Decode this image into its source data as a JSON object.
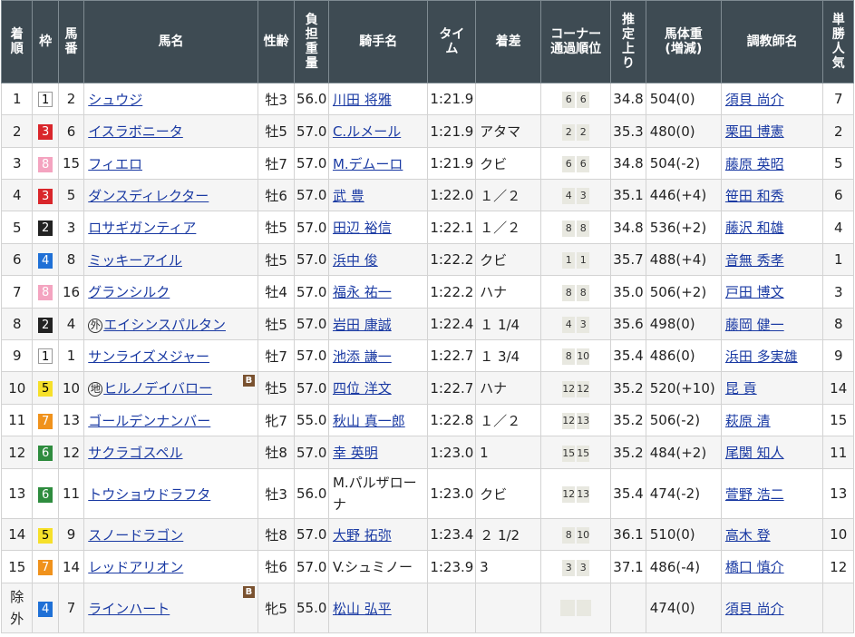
{
  "headers": {
    "chakujun": "着順",
    "waku": "枠",
    "umaban": "馬番",
    "bamei": "馬名",
    "seirei": "性齢",
    "futan": "負担重量",
    "kishu": "騎手名",
    "time": "タイム",
    "chakusa": "着差",
    "corner": "コーナー通過順位",
    "agari": "推定上り",
    "bataiju": "馬体重(増減)",
    "chokyoshi": "調教師名",
    "ninki": "単勝人気"
  },
  "rows": [
    {
      "pos": "1",
      "waku": "1",
      "num": "2",
      "prefix": "",
      "name": "シュウジ",
      "b": false,
      "sex": "牡3",
      "wt": "56.0",
      "jockey": "川田 将雅",
      "jlink": true,
      "time": "1:21.9",
      "margin": "",
      "c1": "6",
      "c2": "6",
      "agari": "34.8",
      "bw": "504(0)",
      "trainer": "須貝 尚介",
      "pop": "7"
    },
    {
      "pos": "2",
      "waku": "3",
      "num": "6",
      "prefix": "",
      "name": "イスラボニータ",
      "b": false,
      "sex": "牡5",
      "wt": "57.0",
      "jockey": "C.ルメール",
      "jlink": true,
      "time": "1:21.9",
      "margin": "アタマ",
      "c1": "2",
      "c2": "2",
      "agari": "35.3",
      "bw": "480(0)",
      "trainer": "栗田 博憲",
      "pop": "2"
    },
    {
      "pos": "3",
      "waku": "8",
      "num": "15",
      "prefix": "",
      "name": "フィエロ",
      "b": false,
      "sex": "牡7",
      "wt": "57.0",
      "jockey": "M.デムーロ",
      "jlink": true,
      "time": "1:21.9",
      "margin": "クビ",
      "c1": "6",
      "c2": "6",
      "agari": "34.8",
      "bw": "504(-2)",
      "trainer": "藤原 英昭",
      "pop": "5"
    },
    {
      "pos": "4",
      "waku": "3",
      "num": "5",
      "prefix": "",
      "name": "ダンスディレクター",
      "b": false,
      "sex": "牡6",
      "wt": "57.0",
      "jockey": "武 豊",
      "jlink": true,
      "time": "1:22.0",
      "margin": "１／２",
      "c1": "4",
      "c2": "3",
      "agari": "35.1",
      "bw": "446(+4)",
      "trainer": "笹田 和秀",
      "pop": "6"
    },
    {
      "pos": "5",
      "waku": "2",
      "num": "3",
      "prefix": "",
      "name": "ロサギガンティア",
      "b": false,
      "sex": "牡5",
      "wt": "57.0",
      "jockey": "田辺 裕信",
      "jlink": true,
      "time": "1:22.1",
      "margin": "１／２",
      "c1": "8",
      "c2": "8",
      "agari": "34.8",
      "bw": "536(+2)",
      "trainer": "藤沢 和雄",
      "pop": "4"
    },
    {
      "pos": "6",
      "waku": "4",
      "num": "8",
      "prefix": "",
      "name": "ミッキーアイル",
      "b": false,
      "sex": "牡5",
      "wt": "57.0",
      "jockey": "浜中 俊",
      "jlink": true,
      "time": "1:22.2",
      "margin": "クビ",
      "c1": "1",
      "c2": "1",
      "agari": "35.7",
      "bw": "488(+4)",
      "trainer": "音無 秀孝",
      "pop": "1"
    },
    {
      "pos": "7",
      "waku": "8",
      "num": "16",
      "prefix": "",
      "name": "グランシルク",
      "b": false,
      "sex": "牡4",
      "wt": "57.0",
      "jockey": "福永 祐一",
      "jlink": true,
      "time": "1:22.2",
      "margin": "ハナ",
      "c1": "8",
      "c2": "8",
      "agari": "35.0",
      "bw": "506(+2)",
      "trainer": "戸田 博文",
      "pop": "3"
    },
    {
      "pos": "8",
      "waku": "2",
      "num": "4",
      "prefix": "外",
      "name": "エイシンスパルタン",
      "b": false,
      "sex": "牡5",
      "wt": "57.0",
      "jockey": "岩田 康誠",
      "jlink": true,
      "time": "1:22.4",
      "margin": "１ 1/4",
      "c1": "4",
      "c2": "3",
      "agari": "35.6",
      "bw": "498(0)",
      "trainer": "藤岡 健一",
      "pop": "8"
    },
    {
      "pos": "9",
      "waku": "1",
      "num": "1",
      "prefix": "",
      "name": "サンライズメジャー",
      "b": false,
      "sex": "牡7",
      "wt": "57.0",
      "jockey": "池添 謙一",
      "jlink": true,
      "time": "1:22.7",
      "margin": "１ 3/4",
      "c1": "8",
      "c2": "10",
      "agari": "35.4",
      "bw": "486(0)",
      "trainer": "浜田 多実雄",
      "pop": "9"
    },
    {
      "pos": "10",
      "waku": "5",
      "num": "10",
      "prefix": "地",
      "name": "ヒルノデイバロー",
      "b": true,
      "sex": "牡5",
      "wt": "57.0",
      "jockey": "四位 洋文",
      "jlink": true,
      "time": "1:22.7",
      "margin": "ハナ",
      "c1": "12",
      "c2": "12",
      "agari": "35.2",
      "bw": "520(+10)",
      "trainer": "昆 貢",
      "pop": "14"
    },
    {
      "pos": "11",
      "waku": "7",
      "num": "13",
      "prefix": "",
      "name": "ゴールデンナンバー",
      "b": false,
      "sex": "牝7",
      "wt": "55.0",
      "jockey": "秋山 真一郎",
      "jlink": true,
      "time": "1:22.8",
      "margin": "１／２",
      "c1": "12",
      "c2": "13",
      "agari": "35.2",
      "bw": "506(-2)",
      "trainer": "萩原 清",
      "pop": "15"
    },
    {
      "pos": "12",
      "waku": "6",
      "num": "12",
      "prefix": "",
      "name": "サクラゴスペル",
      "b": false,
      "sex": "牡8",
      "wt": "57.0",
      "jockey": "幸 英明",
      "jlink": true,
      "time": "1:23.0",
      "margin": "1",
      "c1": "15",
      "c2": "15",
      "agari": "35.2",
      "bw": "484(+2)",
      "trainer": "尾関 知人",
      "pop": "11"
    },
    {
      "pos": "13",
      "waku": "6",
      "num": "11",
      "prefix": "",
      "name": "トウショウドラフタ",
      "b": false,
      "sex": "牡3",
      "wt": "56.0",
      "jockey": "M.パルザローナ",
      "jlink": false,
      "time": "1:23.0",
      "margin": "クビ",
      "c1": "12",
      "c2": "13",
      "agari": "35.4",
      "bw": "474(-2)",
      "trainer": "萱野 浩二",
      "pop": "13"
    },
    {
      "pos": "14",
      "waku": "5",
      "num": "9",
      "prefix": "",
      "name": "スノードラゴン",
      "b": false,
      "sex": "牡8",
      "wt": "57.0",
      "jockey": "大野 拓弥",
      "jlink": true,
      "time": "1:23.4",
      "margin": "２ 1/2",
      "c1": "8",
      "c2": "10",
      "agari": "36.1",
      "bw": "510(0)",
      "trainer": "高木 登",
      "pop": "10"
    },
    {
      "pos": "15",
      "waku": "7",
      "num": "14",
      "prefix": "",
      "name": "レッドアリオン",
      "b": false,
      "sex": "牡6",
      "wt": "57.0",
      "jockey": "V.シュミノー",
      "jlink": false,
      "time": "1:23.9",
      "margin": "3",
      "c1": "3",
      "c2": "3",
      "agari": "37.1",
      "bw": "486(-4)",
      "trainer": "橋口 慎介",
      "pop": "12"
    },
    {
      "pos": "除外",
      "waku": "4",
      "num": "7",
      "prefix": "",
      "name": "ラインハート",
      "b": true,
      "sex": "牝5",
      "wt": "55.0",
      "jockey": "松山 弘平",
      "jlink": true,
      "time": "",
      "margin": "",
      "c1": "",
      "c2": "",
      "agari": "",
      "bw": "474(0)",
      "trainer": "須貝 尚介",
      "pop": ""
    }
  ]
}
